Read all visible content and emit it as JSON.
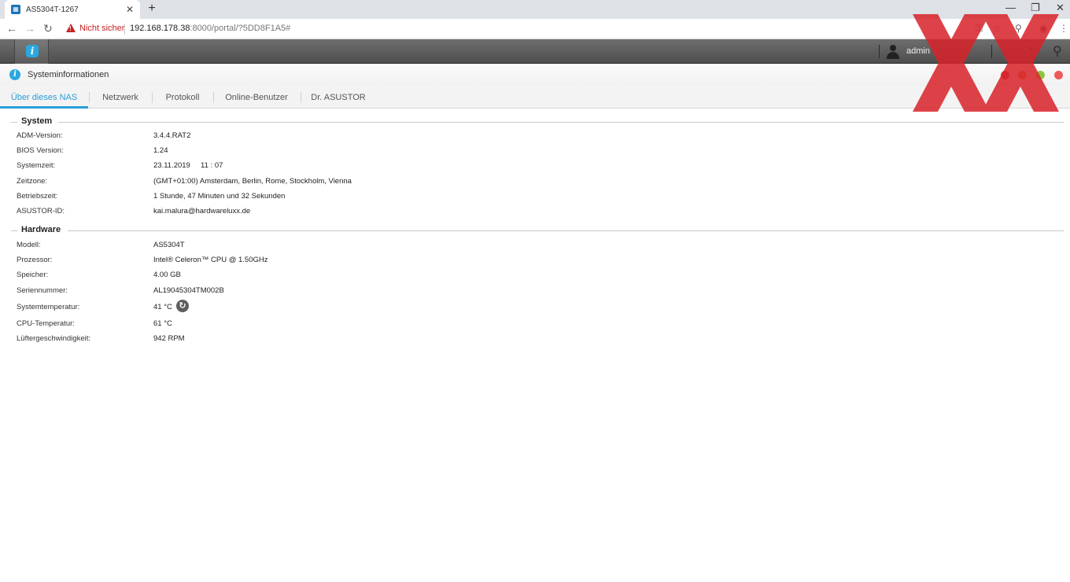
{
  "browser": {
    "tab_title": "AS5304T-1267",
    "new_tab": "+",
    "security_label": "Nicht sicher",
    "url_host": "192.168.178.38",
    "url_rest": ":8000/portal/?5DD8F1A5#"
  },
  "adm": {
    "username": "admin"
  },
  "window": {
    "title": "Systeminformationen",
    "tabs": [
      {
        "label": "Über dieses NAS"
      },
      {
        "label": "Netzwerk"
      },
      {
        "label": "Protokoll"
      },
      {
        "label": "Online-Benutzer"
      },
      {
        "label": "Dr. ASUSTOR"
      }
    ]
  },
  "system": {
    "title": "System",
    "rows": [
      {
        "label": "ADM-Version:",
        "value": "3.4.4.RAT2"
      },
      {
        "label": "BIOS Version:",
        "value": "1.24"
      },
      {
        "label": "Systemzeit:",
        "value": "23.11.2019     11 : 07"
      },
      {
        "label": "Zeitzone:",
        "value": "(GMT+01:00) Amsterdam, Berlin, Rome, Stockholm, Vienna"
      },
      {
        "label": "Betriebszeit:",
        "value": "1 Stunde, 47 Minuten und 32 Sekunden"
      },
      {
        "label": "ASUSTOR-ID:",
        "value": "kai.malura@hardwareluxx.de"
      }
    ]
  },
  "hardware": {
    "title": "Hardware",
    "rows": [
      {
        "label": "Modell:",
        "value": "AS5304T"
      },
      {
        "label": "Prozessor:",
        "value": "Intel® Celeron™ CPU @ 1.50GHz"
      },
      {
        "label": "Speicher:",
        "value": "4.00 GB"
      },
      {
        "label": "Seriennummer:",
        "value": "AL19045304TM002B"
      },
      {
        "label": "Systemtemperatur:",
        "value": "41 °C"
      },
      {
        "label": "CPU-Temperatur:",
        "value": "61 °C"
      },
      {
        "label": "Lüftergeschwindigkeit:",
        "value": "942 RPM"
      }
    ]
  },
  "colors": {
    "accent": "#2a9fd6",
    "warning": "#c5221f",
    "watermark": "#d9222a"
  }
}
